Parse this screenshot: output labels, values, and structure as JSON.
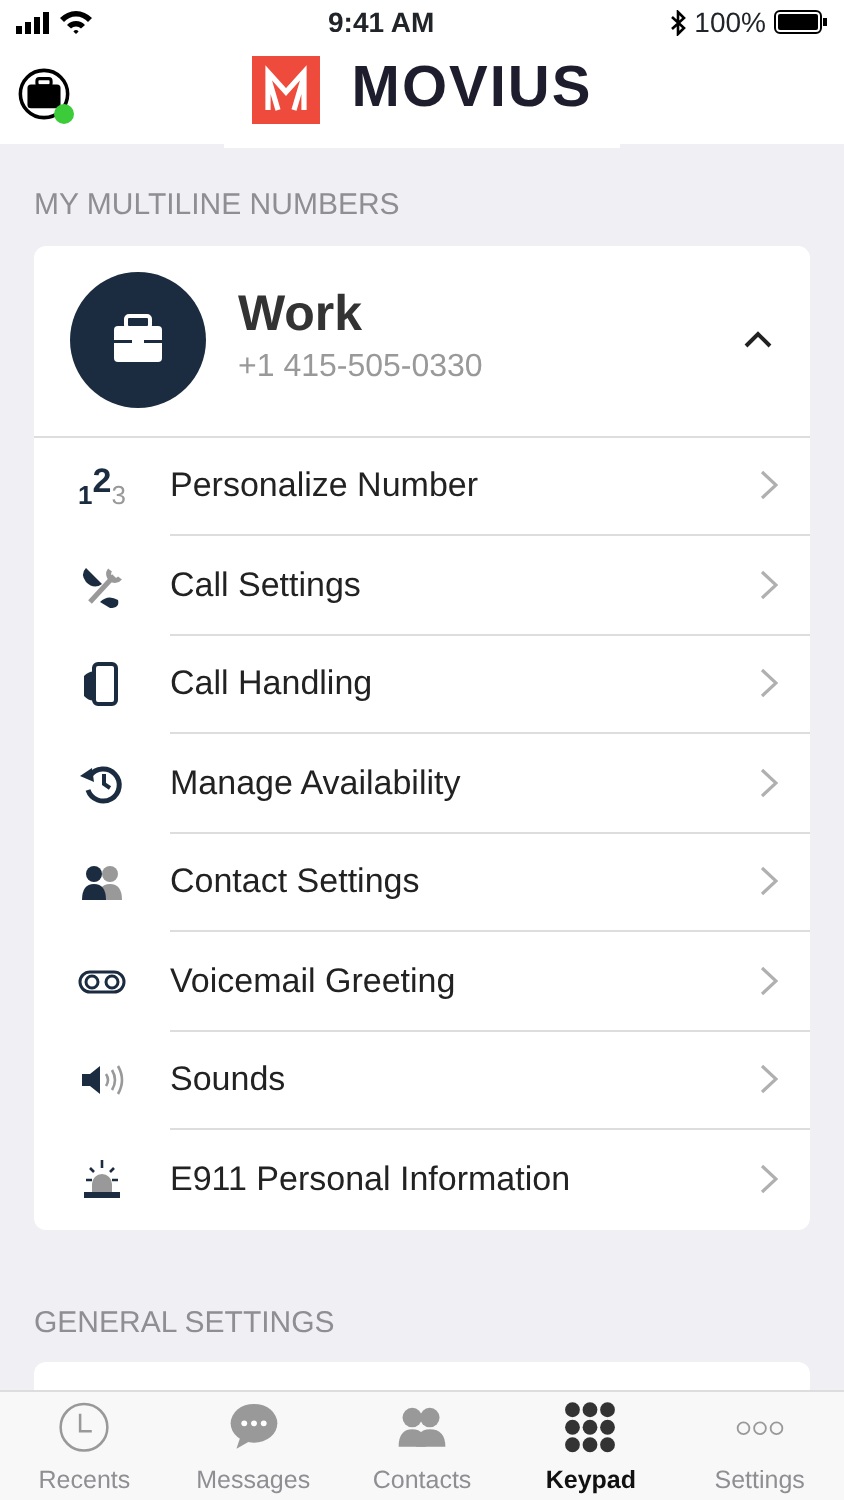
{
  "status_bar": {
    "time": "9:41 AM",
    "battery": "100%"
  },
  "header": {
    "brand": "MOVIUS",
    "online": true
  },
  "sections": [
    {
      "title": "MY MULTILINE NUMBERS"
    },
    {
      "title": "GENERAL SETTINGS"
    }
  ],
  "number": {
    "label": "Work",
    "phone": "+1 415-505-0330",
    "expanded": true
  },
  "items": [
    {
      "kind": "digits",
      "icon_digits": [
        "1",
        "2",
        "3"
      ],
      "label": "Personalize Number"
    },
    {
      "kind": "tools",
      "label": "Call Settings"
    },
    {
      "kind": "phone",
      "label": "Call Handling"
    },
    {
      "kind": "history",
      "label": "Manage Availability"
    },
    {
      "kind": "people",
      "label": "Contact Settings"
    },
    {
      "kind": "voicemail",
      "label": "Voicemail Greeting"
    },
    {
      "kind": "speaker",
      "label": "Sounds"
    },
    {
      "kind": "siren",
      "label": "E911 Personal Information"
    }
  ],
  "tabs": [
    {
      "kind": "clock",
      "label": "Recents",
      "selected": false
    },
    {
      "kind": "bubble",
      "label": "Messages",
      "selected": false
    },
    {
      "kind": "people",
      "label": "Contacts",
      "selected": false
    },
    {
      "kind": "keypad",
      "label": "Keypad",
      "selected": true
    },
    {
      "kind": "dots",
      "label": "Settings",
      "selected": false
    }
  ]
}
